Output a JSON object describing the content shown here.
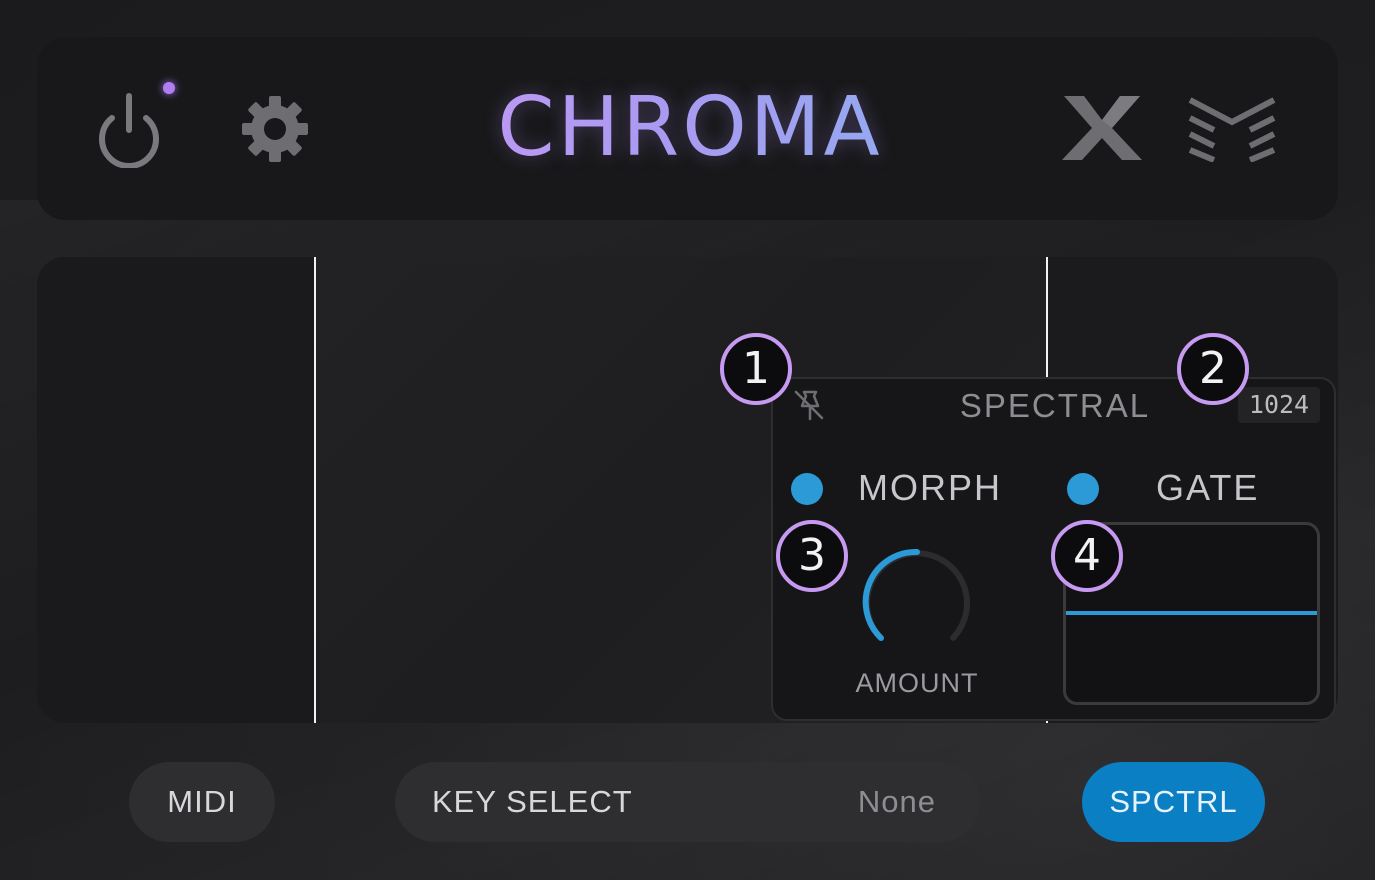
{
  "header": {
    "logo_text": "CHROMA",
    "power_indicator_color": "#b07ef0"
  },
  "icons": {
    "power": "power-icon",
    "settings": "gear-icon",
    "brand": "x-logo-icon",
    "layers": "layers-icon",
    "pin": "pin-off-icon"
  },
  "panel": {
    "title": "SPECTRAL",
    "fft_size": "1024",
    "morph_label": "MORPH",
    "gate_label": "GATE",
    "knob_label": "AMOUNT",
    "led_color": "#2b9ad6"
  },
  "callouts": [
    "1",
    "2",
    "3",
    "4"
  ],
  "bottom_bar": {
    "midi_label": "MIDI",
    "key_select_label": "KEY SELECT",
    "key_select_value": "None",
    "spctrl_label": "SPCTRL",
    "spctrl_color": "#0a7fc4"
  }
}
